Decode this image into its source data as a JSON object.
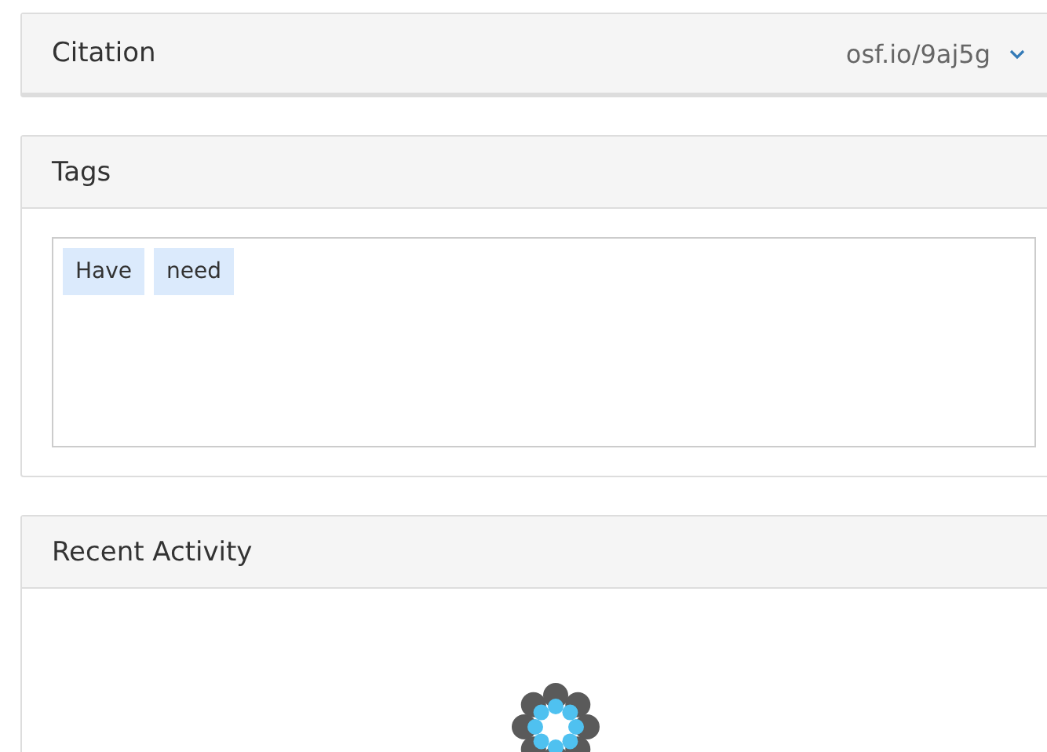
{
  "citation": {
    "title": "Citation",
    "link": "osf.io/9aj5g",
    "expanded": false
  },
  "tags": {
    "title": "Tags",
    "items": [
      "Have",
      "need"
    ]
  },
  "recent_activity": {
    "title": "Recent Activity",
    "loading": true
  }
}
